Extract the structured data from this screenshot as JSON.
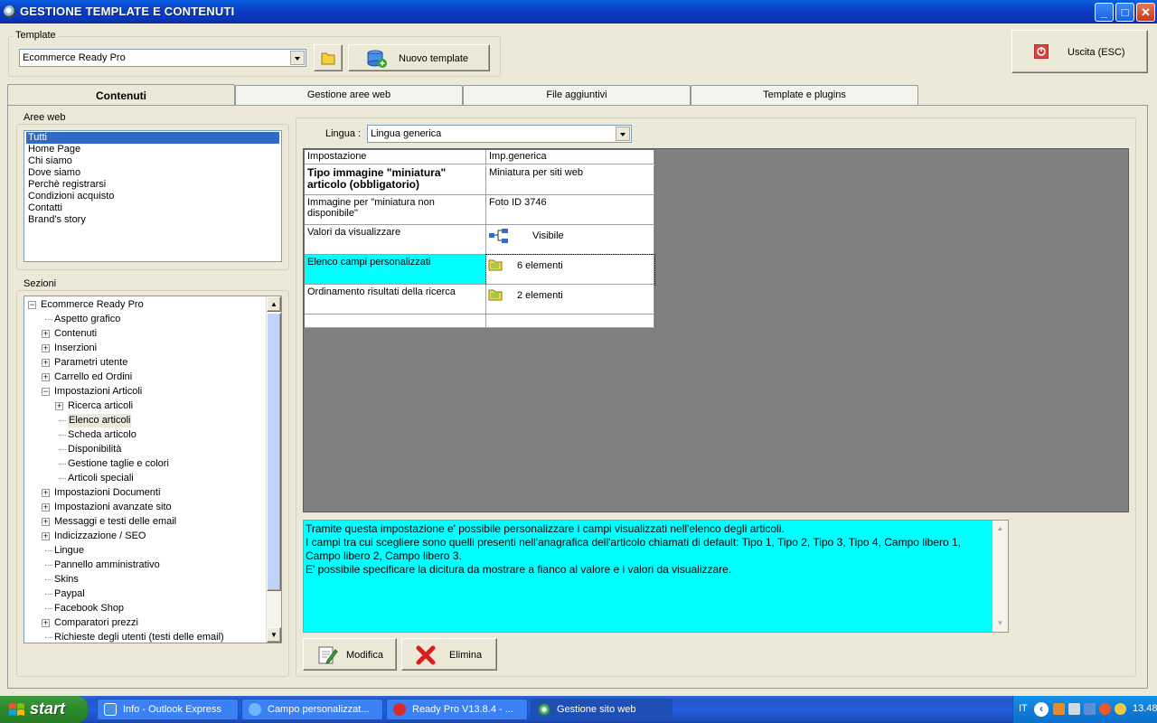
{
  "window": {
    "title": "GESTIONE TEMPLATE E CONTENUTI",
    "minimize": "_",
    "maximize": "□",
    "close": "✕"
  },
  "template_group": {
    "label": "Template",
    "selected": "Ecommerce Ready Pro",
    "new_button": "Nuovo template"
  },
  "exit_button": "Uscita (ESC)",
  "tabs": [
    {
      "label": "Contenuti",
      "active": true
    },
    {
      "label": "Gestione aree web",
      "active": false
    },
    {
      "label": "File aggiuntivi",
      "active": false
    },
    {
      "label": "Template e plugins",
      "active": false
    }
  ],
  "aree_web": {
    "label": "Aree web",
    "items": [
      "Tutti",
      "Home Page",
      "Chi siamo",
      "Dove siamo",
      "Perchè registrarsi",
      "Condizioni acquisto",
      "Contatti",
      "Brand's story"
    ],
    "selected": 0
  },
  "sezioni": {
    "label": "Sezioni",
    "tree": [
      {
        "label": "Ecommerce Ready Pro",
        "level": 0,
        "exp": "-"
      },
      {
        "label": "Aspetto grafico",
        "level": 1,
        "exp": ""
      },
      {
        "label": "Contenuti",
        "level": 1,
        "exp": "+"
      },
      {
        "label": "Inserzioni",
        "level": 1,
        "exp": "+"
      },
      {
        "label": "Parametri utente",
        "level": 1,
        "exp": "+"
      },
      {
        "label": "Carrello ed Ordini",
        "level": 1,
        "exp": "+"
      },
      {
        "label": "Impostazioni Articoli",
        "level": 1,
        "exp": "-"
      },
      {
        "label": "Ricerca articoli",
        "level": 2,
        "exp": "+"
      },
      {
        "label": "Elenco articoli",
        "level": 2,
        "exp": "",
        "selected": true
      },
      {
        "label": "Scheda articolo",
        "level": 2,
        "exp": ""
      },
      {
        "label": "Disponibilità",
        "level": 2,
        "exp": ""
      },
      {
        "label": "Gestione taglie e colori",
        "level": 2,
        "exp": ""
      },
      {
        "label": "Articoli speciali",
        "level": 2,
        "exp": ""
      },
      {
        "label": "Impostazioni Documenti",
        "level": 1,
        "exp": "+"
      },
      {
        "label": "Impostazioni avanzate sito",
        "level": 1,
        "exp": "+"
      },
      {
        "label": "Messaggi e testi delle email",
        "level": 1,
        "exp": "+"
      },
      {
        "label": "Indicizzazione / SEO",
        "level": 1,
        "exp": "+"
      },
      {
        "label": "Lingue",
        "level": 1,
        "exp": ""
      },
      {
        "label": "Pannello amministrativo",
        "level": 1,
        "exp": ""
      },
      {
        "label": "Skins",
        "level": 1,
        "exp": ""
      },
      {
        "label": "Paypal",
        "level": 1,
        "exp": ""
      },
      {
        "label": "Facebook Shop",
        "level": 1,
        "exp": ""
      },
      {
        "label": "Comparatori prezzi",
        "level": 1,
        "exp": "+"
      },
      {
        "label": "Richieste degli utenti (testi delle email)",
        "level": 1,
        "exp": ""
      }
    ]
  },
  "lingua": {
    "label": "Lingua :",
    "selected": "Lingua generica"
  },
  "grid": {
    "headers": [
      "Impostazione",
      "Imp.generica"
    ],
    "rows": [
      {
        "name": "Tipo immagine \"miniatura\" articolo (obbligatorio)",
        "bold": true,
        "value": "Miniatura per siti web",
        "icon": ""
      },
      {
        "name": "Immagine per \"miniatura non disponibile\"",
        "bold": false,
        "value": "Foto ID 3746",
        "icon": ""
      },
      {
        "name": "Valori da visualizzare",
        "bold": false,
        "value": "Visibile",
        "icon": "tree-icon"
      },
      {
        "name": "Elenco campi personalizzati",
        "bold": false,
        "value": "6 elementi",
        "icon": "folder-icon",
        "highlight": true
      },
      {
        "name": "Ordinamento risultati della ricerca",
        "bold": false,
        "value": "2 elementi",
        "icon": "folder-icon"
      }
    ]
  },
  "description": {
    "lines": [
      "Tramite questa impostazione e' possibile personalizzare i campi visualizzati nell'elenco degli articoli.",
      "I campi tra cui scegliere sono quelli presenti nell'anagrafica dell'articolo chiamati di default: Tipo 1, Tipo 2, Tipo 3, Tipo 4, Campo libero 1,",
      "Campo libero 2, Campo libero 3.",
      "E' possibile specificare la dicitura da mostrare a fianco al valore e i valori da visualizzare."
    ]
  },
  "actions": {
    "modify": "Modifica",
    "delete": "Elimina"
  },
  "taskbar": {
    "start": "start",
    "tasks": [
      {
        "label": "Info - Outlook Express",
        "active": false
      },
      {
        "label": "Campo personalizzat...",
        "active": false
      },
      {
        "label": "Ready Pro V13.8.4 - ...",
        "active": false
      },
      {
        "label": "Gestione sito web",
        "active": true
      }
    ],
    "lang": "IT",
    "clock": "13.48"
  },
  "colors": {
    "highlight": "#00ffff",
    "selection": "#316ac5",
    "grid_bg": "#808080"
  }
}
